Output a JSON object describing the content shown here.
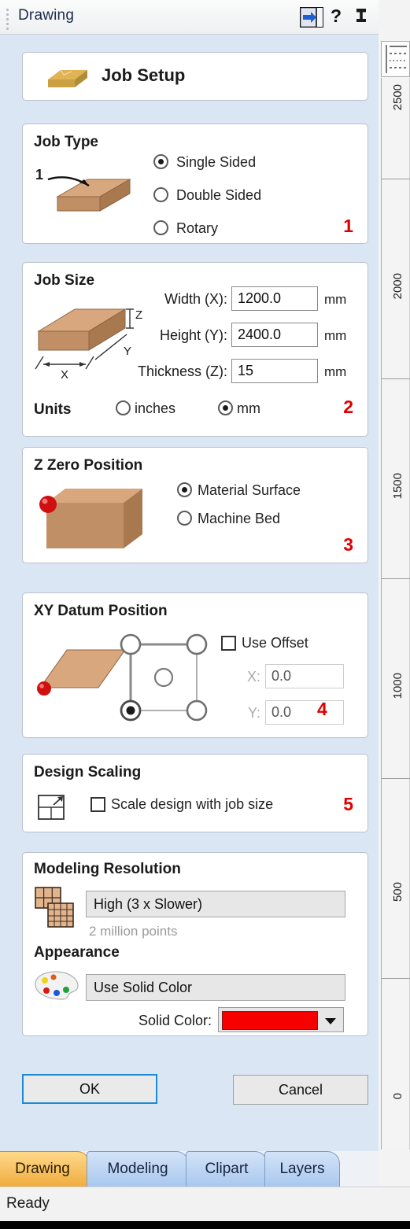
{
  "window": {
    "title": "Drawing",
    "buttons": {
      "autohide": "auto-hide",
      "help": "?",
      "pin": "pin"
    }
  },
  "header": {
    "title": "Job Setup",
    "icon": "job-setup-block-icon"
  },
  "job_type": {
    "title": "Job Type",
    "step": "1",
    "icon_label": "1",
    "options": [
      {
        "label": "Single Sided",
        "selected": true
      },
      {
        "label": "Double Sided",
        "selected": false
      },
      {
        "label": "Rotary",
        "selected": false
      }
    ]
  },
  "job_size": {
    "title": "Job Size",
    "step": "2",
    "fields": [
      {
        "label": "Width (X):",
        "value": "1200.0",
        "unit": "mm"
      },
      {
        "label": "Height (Y):",
        "value": "2400.0",
        "unit": "mm"
      },
      {
        "label": "Thickness (Z):",
        "value": "15",
        "unit": "mm"
      }
    ],
    "units_label": "Units",
    "units": [
      {
        "label": "inches",
        "selected": false
      },
      {
        "label": "mm",
        "selected": true
      }
    ],
    "diagram_labels": {
      "z": "Z",
      "y": "Y",
      "x": "X"
    }
  },
  "z_zero": {
    "title": "Z Zero Position",
    "step": "3",
    "options": [
      {
        "label": "Material Surface",
        "selected": true
      },
      {
        "label": "Machine Bed",
        "selected": false
      }
    ]
  },
  "xy_datum": {
    "title": "XY Datum Position",
    "step": "4",
    "use_offset": {
      "label": "Use Offset",
      "checked": false
    },
    "x": {
      "label": "X:",
      "value": "0.0",
      "enabled": false
    },
    "y": {
      "label": "Y:",
      "value": "0.0",
      "enabled": false
    },
    "selected_datum": "bottom-left"
  },
  "design_scaling": {
    "title": "Design Scaling",
    "step": "5",
    "checkbox": {
      "label": "Scale design with job size",
      "checked": false
    }
  },
  "modeling": {
    "resolution_title": "Modeling Resolution",
    "resolution_value": "High (3 x Slower)",
    "points_note": "2 million points",
    "appearance_title": "Appearance",
    "appearance_value": "Use Solid Color",
    "solid_color_label": "Solid Color:",
    "solid_color": "#f70000"
  },
  "dialog_buttons": {
    "ok": "OK",
    "cancel": "Cancel"
  },
  "tabs": [
    {
      "label": "Drawing",
      "active": true
    },
    {
      "label": "Modeling",
      "active": false
    },
    {
      "label": "Clipart",
      "active": false
    },
    {
      "label": "Layers",
      "active": false
    }
  ],
  "status": {
    "text": "Ready"
  },
  "ruler": {
    "orientation": "vertical",
    "unit": "mm",
    "ticks": [
      "2500",
      "2000",
      "1500",
      "1000",
      "500",
      "0"
    ]
  },
  "colors": {
    "panel_background": "#dbe6f4",
    "group_background": "#ffffff",
    "accent_step": "#e00000",
    "tab_active": "#f0ad3f",
    "tab_inactive": "#a9c8ef",
    "default_button_border": "#1e8ad6"
  }
}
